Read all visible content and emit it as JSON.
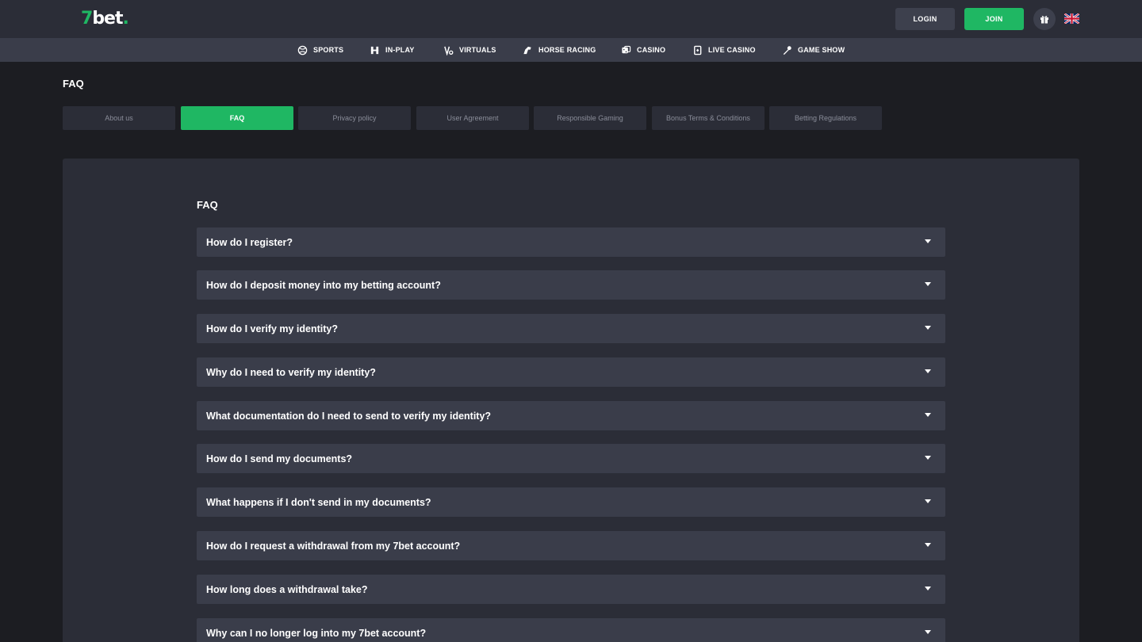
{
  "header": {
    "logo_seven": "7",
    "logo_bet": "bet",
    "logo_dot": ".",
    "login_label": "LOGIN",
    "join_label": "JOIN",
    "gift_icon": "gift-icon",
    "language_flag": "uk-flag-icon"
  },
  "nav": {
    "items": [
      {
        "label": "SPORTS",
        "icon": "sports-ball-icon"
      },
      {
        "label": "IN-PLAY",
        "icon": "in-play-icon"
      },
      {
        "label": "VIRTUALS",
        "icon": "virtuals-icon"
      },
      {
        "label": "HORSE RACING",
        "icon": "horse-icon"
      },
      {
        "label": "CASINO",
        "icon": "dice-icon"
      },
      {
        "label": "LIVE CASINO",
        "icon": "cards-icon"
      },
      {
        "label": "GAME SHOW",
        "icon": "microphone-icon"
      }
    ]
  },
  "page": {
    "title": "FAQ",
    "tabs": [
      {
        "label": "About us",
        "active": false
      },
      {
        "label": "FAQ",
        "active": true
      },
      {
        "label": "Privacy policy",
        "active": false
      },
      {
        "label": "User Agreement",
        "active": false
      },
      {
        "label": "Responsible Gaming",
        "active": false
      },
      {
        "label": "Bonus Terms & Conditions",
        "active": false
      },
      {
        "label": "Betting Regulations",
        "active": false
      }
    ]
  },
  "faq": {
    "title": "FAQ",
    "questions": [
      "How do I register?",
      "How do I deposit money into my betting account?",
      "How do I verify my identity?",
      "Why do I need to verify my identity?",
      "What documentation do I need to send to verify my identity?",
      "How do I send my documents?",
      "What happens if I don't send in my documents?",
      "How do I request a withdrawal from my 7bet account?",
      "How long does a withdrawal take?",
      "Why can I no longer log into my 7bet account?"
    ]
  },
  "colors": {
    "brand_green": "#1fb763",
    "header_bg": "#2b2d37",
    "nav_bg": "#3a3d4a",
    "page_bg": "#1c1d22",
    "panel_bg": "#2b2d37",
    "item_bg": "#3a3d4a"
  }
}
